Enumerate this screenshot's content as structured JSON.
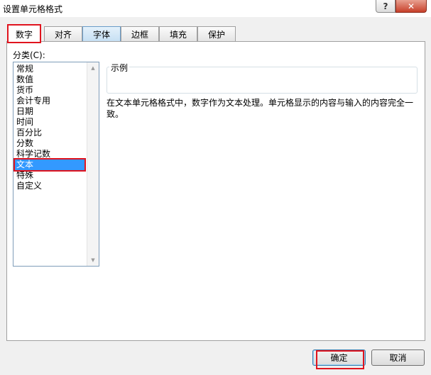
{
  "window": {
    "title": "设置单元格格式",
    "help_label": "?",
    "close_label": "✕"
  },
  "tabs": [
    {
      "label": "数字",
      "active": true
    },
    {
      "label": "对齐"
    },
    {
      "label": "字体"
    },
    {
      "label": "边框"
    },
    {
      "label": "填充"
    },
    {
      "label": "保护"
    }
  ],
  "category": {
    "label": "分类(C):",
    "items": [
      "常规",
      "数值",
      "货币",
      "会计专用",
      "日期",
      "时间",
      "百分比",
      "分数",
      "科学记数",
      "文本",
      "特殊",
      "自定义"
    ],
    "selected": "文本"
  },
  "sample": {
    "label": "示例",
    "value": ""
  },
  "description": "在文本单元格格式中，数字作为文本处理。单元格显示的内容与输入的内容完全一致。",
  "buttons": {
    "ok": "确定",
    "cancel": "取消"
  },
  "colors": {
    "highlight_box": "#e0141e",
    "selection": "#3399ff"
  },
  "icons": {
    "scroll_up": "triangle-up-icon",
    "scroll_down": "triangle-down-icon"
  }
}
